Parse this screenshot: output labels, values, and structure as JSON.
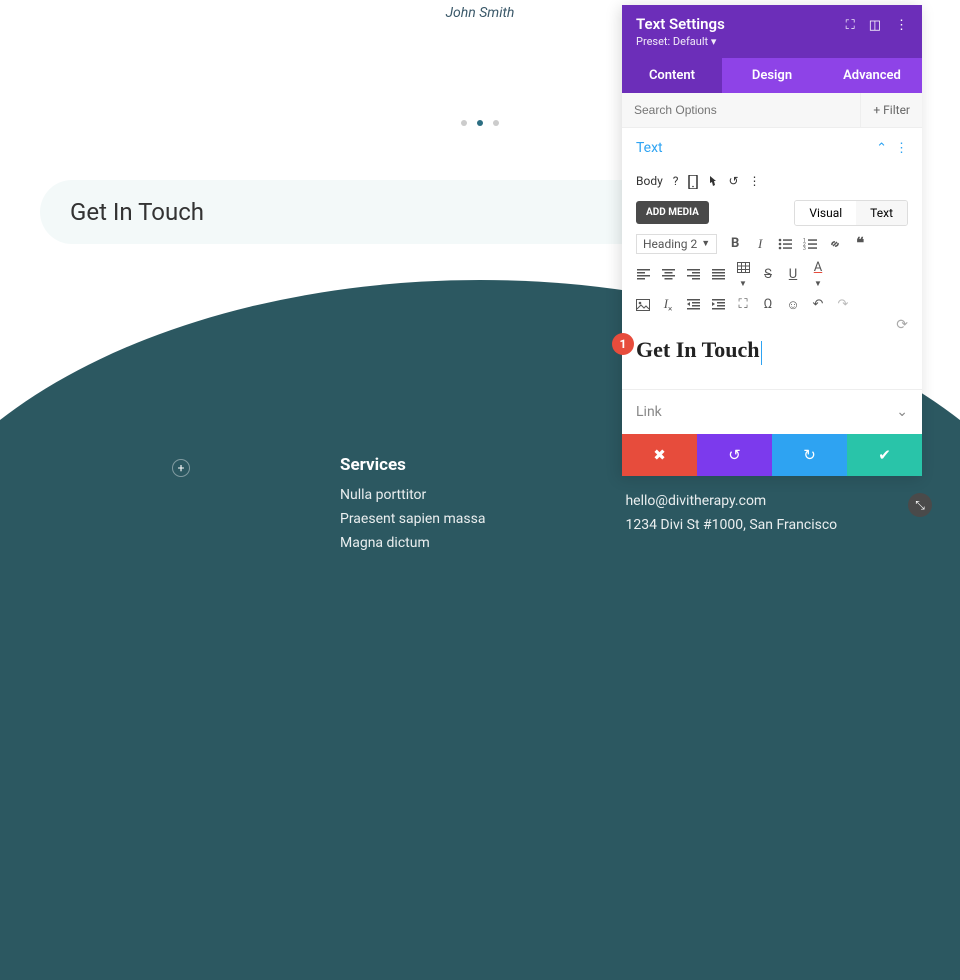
{
  "page": {
    "author": "John Smith",
    "heading": "Get In Touch"
  },
  "footer": {
    "services": {
      "title": "Services",
      "items": [
        "Nulla porttitor",
        "Praesent sapien massa",
        "Magna dictum"
      ]
    },
    "contact": {
      "email": "hello@divitherapy.com",
      "address": "1234 Divi St #1000, San Francisco"
    }
  },
  "panel": {
    "title": "Text Settings",
    "preset_label": "Preset:",
    "preset_value": "Default",
    "tabs": {
      "content": "Content",
      "design": "Design",
      "advanced": "Advanced"
    },
    "search_placeholder": "Search Options",
    "filter_label": "Filter",
    "sections": {
      "text": {
        "label": "Text",
        "body_label": "Body",
        "add_media": "ADD MEDIA",
        "editor_tabs": {
          "visual": "Visual",
          "text": "Text"
        },
        "heading_select": "Heading 2",
        "content": "Get In Touch"
      },
      "link": {
        "label": "Link"
      }
    },
    "callout_number": "1"
  }
}
